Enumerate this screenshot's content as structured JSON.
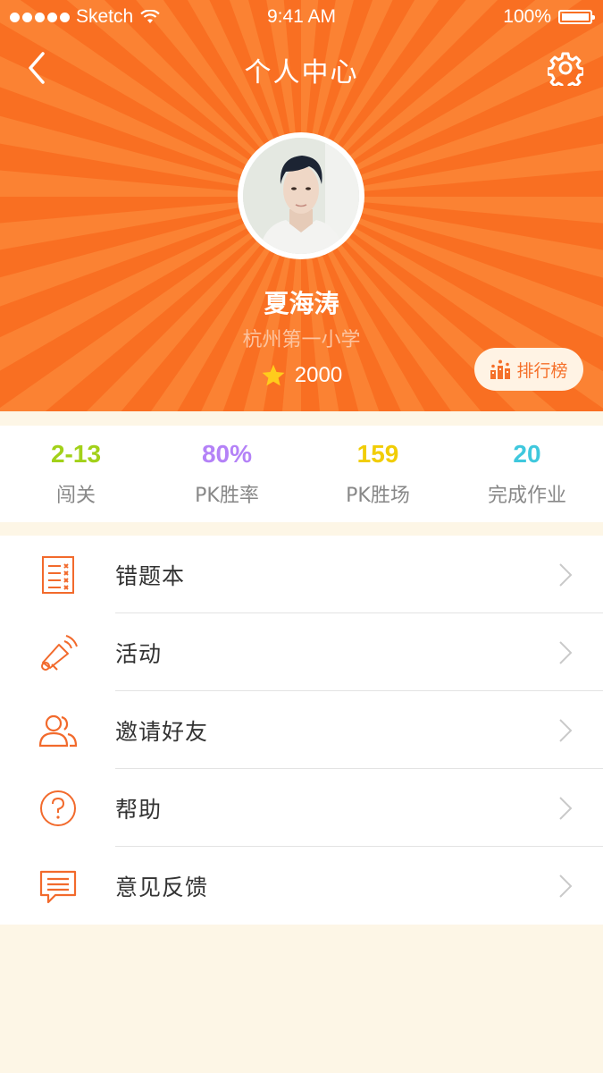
{
  "status_bar": {
    "carrier": "Sketch",
    "time": "9:41 AM",
    "battery": "100%"
  },
  "nav": {
    "title": "个人中心"
  },
  "profile": {
    "name": "夏海涛",
    "school": "杭州第一小学",
    "score": "2000",
    "rank_label": "排行榜"
  },
  "stats": [
    {
      "value": "2-13",
      "label": "闯关",
      "color": "#a2d119"
    },
    {
      "value": "80%",
      "label": "PK胜率",
      "color": "#b482f7"
    },
    {
      "value": "159",
      "label": "PK胜场",
      "color": "#f1cd06"
    },
    {
      "value": "20",
      "label": "完成作业",
      "color": "#3fc8dd"
    }
  ],
  "menu": [
    {
      "label": "错题本",
      "icon": "notebook-icon"
    },
    {
      "label": "活动",
      "icon": "megaphone-icon"
    },
    {
      "label": "邀请好友",
      "icon": "friends-icon"
    },
    {
      "label": "帮助",
      "icon": "help-icon"
    },
    {
      "label": "意见反馈",
      "icon": "feedback-icon"
    }
  ],
  "colors": {
    "header": "#f96f22",
    "accent": "#f5702a",
    "page_bg": "#fdf6e6"
  }
}
